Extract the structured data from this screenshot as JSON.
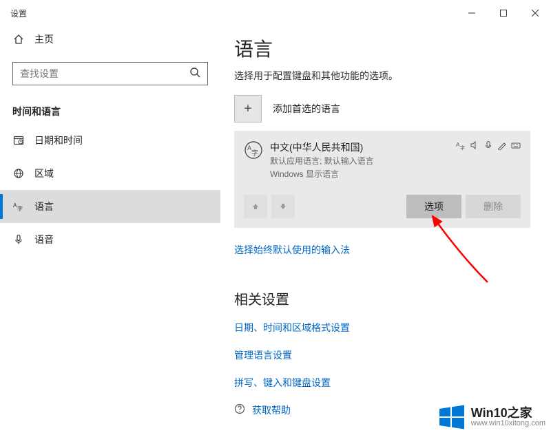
{
  "window": {
    "title": "设置"
  },
  "sidebar": {
    "home_label": "主页",
    "search_placeholder": "查找设置",
    "section_label": "时间和语言",
    "items": [
      {
        "label": "日期和时间"
      },
      {
        "label": "区域"
      },
      {
        "label": "语言"
      },
      {
        "label": "语音"
      }
    ]
  },
  "main": {
    "page_title": "语言",
    "page_subtitle": "选择用于配置键盘和其他功能的选项。",
    "add_language_label": "添加首选的语言",
    "lang_card": {
      "name": "中文(中华人民共和国)",
      "detail_line1": "默认应用语言; 默认输入语言",
      "detail_line2": "Windows 显示语言",
      "options_label": "选项",
      "delete_label": "删除"
    },
    "input_method_link": "选择始终默认使用的输入法",
    "related": {
      "header": "相关设置",
      "links": [
        "日期、时间和区域格式设置",
        "管理语言设置",
        "拼写、键入和键盘设置"
      ]
    },
    "help_label": "获取帮助"
  },
  "watermark": {
    "brand": "Win10之家",
    "url": "www.win10xitong.com"
  }
}
